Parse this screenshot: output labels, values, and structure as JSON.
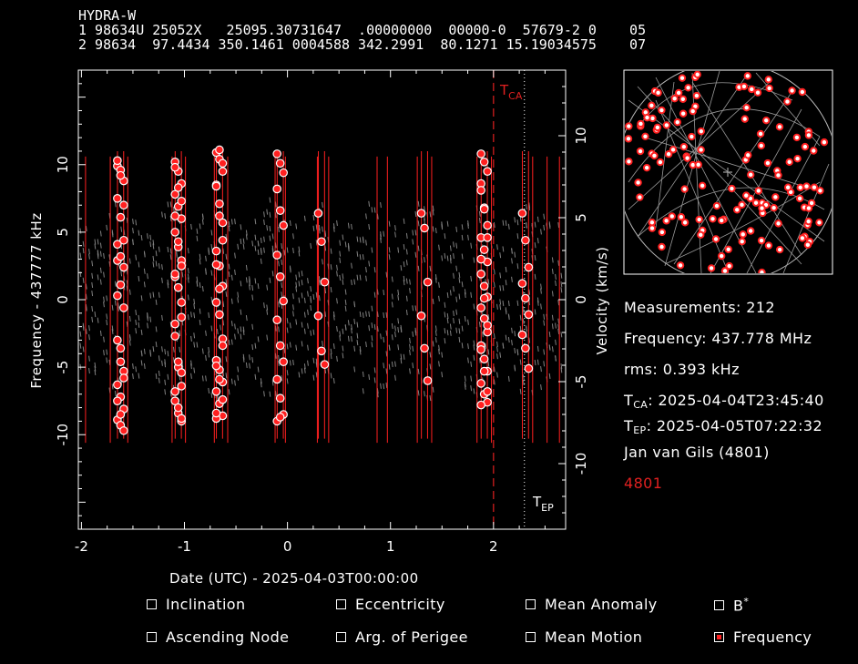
{
  "header": {
    "name": "HYDRA-W",
    "tle_line1": "1 98634U 25052X   25095.30731647  .00000000  00000-0  57679-2 0    05",
    "tle_line2": "2 98634  97.4434 350.1461 0004588 342.2991  80.1271 15.19034575    07"
  },
  "plot": {
    "y_left_label": "Frequency - 437777 kHz",
    "y_right_label": "Velocity (km/s)",
    "x_label": "Date (UTC) - 2025-04-03T00:00:00",
    "x_ticks": [
      "-2",
      "-1",
      "0",
      "1",
      "2"
    ],
    "y_left_ticks": [
      "10",
      "5",
      "0",
      "-5",
      "-10"
    ],
    "y_right_ticks": [
      "10",
      "5",
      "0",
      "-5",
      "-10"
    ],
    "tca_label": "T",
    "tca_sub": "CA",
    "tep_label": "T",
    "tep_sub": "EP",
    "colors": {
      "measurements": "#ff2020",
      "model": "#808080",
      "tca_line": "#e02020",
      "tep_line": "#ffffff"
    }
  },
  "chart_data": {
    "type": "scatter",
    "xlim": [
      -2.03,
      2.7
    ],
    "ylim": [
      -17,
      17
    ],
    "y2lim": [
      -14,
      14
    ],
    "tca_x": 2.0,
    "tep_x": 2.3,
    "measurement_passes": [
      {
        "x": -1.62,
        "y": [
          9.9,
          9.6,
          8.8,
          7.5,
          6.1,
          4.4,
          2.9,
          1.1,
          -0.6,
          -3.0,
          -4.6,
          -5.3,
          -6.3,
          -7.2,
          -8.1,
          -8.9,
          -9.3,
          -9.7,
          10.3,
          9.2,
          7.0,
          4.1,
          3.2,
          2.4,
          0.3,
          -3.6,
          -5.8,
          -7.5,
          -8.5
        ]
      },
      {
        "x": -1.06,
        "y": [
          10.2,
          9.5,
          8.6,
          7.8,
          6.9,
          6.0,
          5.0,
          3.9,
          2.9,
          1.7,
          0.9,
          -0.2,
          -1.8,
          -5.0,
          -6.4,
          -7.5,
          -8.4,
          -9.0,
          9.8,
          8.3,
          7.3,
          6.2,
          4.3,
          2.5,
          1.9,
          0.9,
          -1.3,
          -2.7,
          -4.6,
          -5.4,
          -6.8,
          -8.0,
          -8.8
        ]
      },
      {
        "x": -0.66,
        "y": [
          10.9,
          10.4,
          9.5,
          8.5,
          7.1,
          5.7,
          3.6,
          2.5,
          1.0,
          -0.2,
          -1.1,
          -2.9,
          -4.5,
          -5.2,
          -6.1,
          -6.8,
          -7.7,
          -8.6,
          -8.8,
          11.1,
          10.1,
          8.4,
          6.2,
          4.4,
          2.6,
          0.8,
          -3.4,
          -4.9,
          -5.9,
          -7.4,
          -8.4
        ]
      },
      {
        "x": -0.07,
        "y": [
          10.8,
          10.1,
          9.4,
          8.2,
          6.6,
          5.5,
          3.3,
          1.7,
          -0.1,
          -1.5,
          -3.4,
          -4.6,
          -5.9,
          -7.3,
          -8.5,
          -9.0,
          -8.7
        ]
      },
      {
        "x": 0.33,
        "y": [
          6.4,
          4.3,
          1.3,
          -1.2,
          -3.8,
          -4.8
        ]
      },
      {
        "x": 1.33,
        "y": [
          6.4,
          5.3,
          1.3,
          -1.2,
          -3.6,
          -6.0
        ]
      },
      {
        "x": 1.91,
        "y": [
          10.8,
          10.2,
          9.5,
          8.6,
          6.8,
          5.5,
          4.6,
          3.7,
          2.8,
          1.9,
          1.0,
          0.2,
          -0.6,
          -1.4,
          -2.4,
          -3.4,
          -4.4,
          -5.3,
          -6.2,
          -7.0,
          -7.6,
          8.1,
          6.7,
          4.6,
          3.0,
          0.1,
          -1.9,
          -3.7,
          -5.3,
          -6.8,
          -7.8
        ]
      },
      {
        "x": 2.31,
        "y": [
          6.4,
          4.4,
          2.4,
          1.2,
          0.1,
          -1.1,
          -2.6,
          -3.6,
          -5.1
        ]
      }
    ],
    "model_line_x": [
      -1.96,
      -1.72,
      -1.55,
      -1.12,
      -0.99,
      -0.71,
      -0.58,
      -0.12,
      -0.02,
      0.29,
      0.4,
      0.87,
      0.97,
      1.26,
      1.4,
      1.84,
      1.98,
      2.38,
      2.52,
      2.64
    ]
  },
  "stats": {
    "measurements": "Measurements: 212",
    "frequency": "Frequency: 437.778 MHz",
    "rms": "rms: 0.393 kHz",
    "tca_prefix": "T",
    "tca_sub": "CA",
    "tca_value": ": 2025-04-04T23:45:40",
    "tep_prefix": "T",
    "tep_sub": "EP",
    "tep_value": ": 2025-04-05T07:22:32",
    "observer": "Jan van Gils (4801)",
    "site": "4801"
  },
  "controls": [
    {
      "label": "Inclination",
      "checked": false
    },
    {
      "label": "Eccentricity",
      "checked": false
    },
    {
      "label": "Mean Anomaly",
      "checked": false
    },
    {
      "label": "B*",
      "checked": false
    },
    {
      "label": "Ascending Node",
      "checked": false
    },
    {
      "label": "Arg. of Perigee",
      "checked": false
    },
    {
      "label": "Mean Motion",
      "checked": false
    },
    {
      "label": "Frequency",
      "checked": true
    }
  ]
}
